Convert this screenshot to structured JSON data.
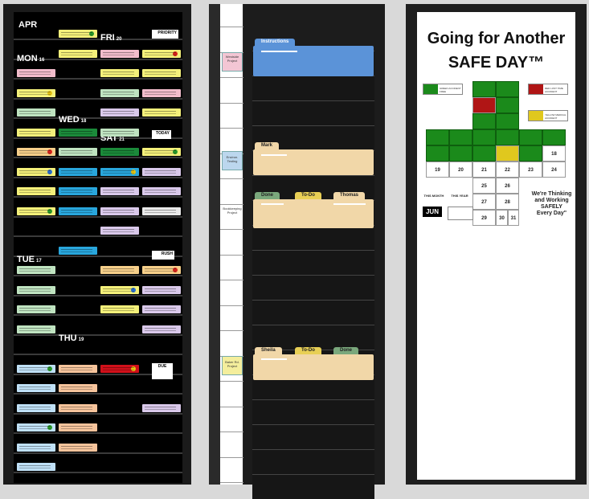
{
  "board": {
    "month": "APR",
    "days": [
      {
        "key": "fri",
        "label": "FRI",
        "num": "20"
      },
      {
        "key": "mon",
        "label": "MON",
        "num": "16"
      },
      {
        "key": "wed",
        "label": "WED",
        "num": "18"
      },
      {
        "key": "sat",
        "label": "SAT",
        "num": "21"
      },
      {
        "key": "tue",
        "label": "TUE",
        "num": "17"
      },
      {
        "key": "thu",
        "label": "THU",
        "num": "19"
      }
    ],
    "tags": {
      "priority": "PRIORITY",
      "today": "TODAY",
      "rush": "RUSH",
      "due": "DUE"
    }
  },
  "strip": {
    "labels": [
      "Westside Project",
      "Environ. Testing",
      "Bookkeeping Project",
      "Baker Rd. Project"
    ]
  },
  "organizer": {
    "folder_labels": [
      "Instructions",
      "Mark",
      "Done",
      "To-Do",
      "Thomas",
      "Sheila",
      "To-Do",
      "Done"
    ]
  },
  "poster": {
    "title_line1": "Going for Another",
    "title_line2": "SAFE DAY™",
    "legend": {
      "green": "GREEN ACCIDENT FREE",
      "red": "RED LOST TIME ACCIDENT",
      "yellow": "YELLOW MEDICAL ACCIDENT"
    },
    "calendar_days": [
      "18",
      "19",
      "20",
      "21",
      "22",
      "23",
      "24",
      "25",
      "26",
      "27",
      "28",
      "29",
      "30",
      "31"
    ],
    "this_month": "THIS MONTH",
    "this_year": "THIS YEAR",
    "month_value": "JUN",
    "slogan": [
      "We're Thinking",
      "and Working",
      "SAFELY",
      "Every Day\""
    ],
    "colors": {
      "green": "#1b8a1b",
      "red": "#b01515",
      "yellow": "#e0c81e",
      "folder_blue": "#5b93d8",
      "folder_manila": "#f1d7a8"
    }
  }
}
